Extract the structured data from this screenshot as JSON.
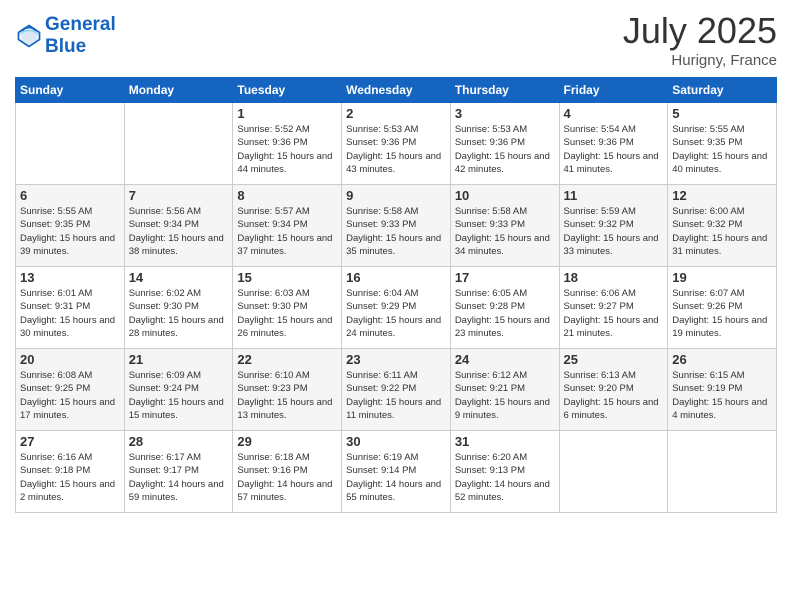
{
  "logo": {
    "line1": "General",
    "line2": "Blue"
  },
  "title": "July 2025",
  "location": "Hurigny, France",
  "weekdays": [
    "Sunday",
    "Monday",
    "Tuesday",
    "Wednesday",
    "Thursday",
    "Friday",
    "Saturday"
  ],
  "rows": [
    [
      {
        "day": "",
        "info": ""
      },
      {
        "day": "",
        "info": ""
      },
      {
        "day": "1",
        "info": "Sunrise: 5:52 AM\nSunset: 9:36 PM\nDaylight: 15 hours and 44 minutes."
      },
      {
        "day": "2",
        "info": "Sunrise: 5:53 AM\nSunset: 9:36 PM\nDaylight: 15 hours and 43 minutes."
      },
      {
        "day": "3",
        "info": "Sunrise: 5:53 AM\nSunset: 9:36 PM\nDaylight: 15 hours and 42 minutes."
      },
      {
        "day": "4",
        "info": "Sunrise: 5:54 AM\nSunset: 9:36 PM\nDaylight: 15 hours and 41 minutes."
      },
      {
        "day": "5",
        "info": "Sunrise: 5:55 AM\nSunset: 9:35 PM\nDaylight: 15 hours and 40 minutes."
      }
    ],
    [
      {
        "day": "6",
        "info": "Sunrise: 5:55 AM\nSunset: 9:35 PM\nDaylight: 15 hours and 39 minutes."
      },
      {
        "day": "7",
        "info": "Sunrise: 5:56 AM\nSunset: 9:34 PM\nDaylight: 15 hours and 38 minutes."
      },
      {
        "day": "8",
        "info": "Sunrise: 5:57 AM\nSunset: 9:34 PM\nDaylight: 15 hours and 37 minutes."
      },
      {
        "day": "9",
        "info": "Sunrise: 5:58 AM\nSunset: 9:33 PM\nDaylight: 15 hours and 35 minutes."
      },
      {
        "day": "10",
        "info": "Sunrise: 5:58 AM\nSunset: 9:33 PM\nDaylight: 15 hours and 34 minutes."
      },
      {
        "day": "11",
        "info": "Sunrise: 5:59 AM\nSunset: 9:32 PM\nDaylight: 15 hours and 33 minutes."
      },
      {
        "day": "12",
        "info": "Sunrise: 6:00 AM\nSunset: 9:32 PM\nDaylight: 15 hours and 31 minutes."
      }
    ],
    [
      {
        "day": "13",
        "info": "Sunrise: 6:01 AM\nSunset: 9:31 PM\nDaylight: 15 hours and 30 minutes."
      },
      {
        "day": "14",
        "info": "Sunrise: 6:02 AM\nSunset: 9:30 PM\nDaylight: 15 hours and 28 minutes."
      },
      {
        "day": "15",
        "info": "Sunrise: 6:03 AM\nSunset: 9:30 PM\nDaylight: 15 hours and 26 minutes."
      },
      {
        "day": "16",
        "info": "Sunrise: 6:04 AM\nSunset: 9:29 PM\nDaylight: 15 hours and 24 minutes."
      },
      {
        "day": "17",
        "info": "Sunrise: 6:05 AM\nSunset: 9:28 PM\nDaylight: 15 hours and 23 minutes."
      },
      {
        "day": "18",
        "info": "Sunrise: 6:06 AM\nSunset: 9:27 PM\nDaylight: 15 hours and 21 minutes."
      },
      {
        "day": "19",
        "info": "Sunrise: 6:07 AM\nSunset: 9:26 PM\nDaylight: 15 hours and 19 minutes."
      }
    ],
    [
      {
        "day": "20",
        "info": "Sunrise: 6:08 AM\nSunset: 9:25 PM\nDaylight: 15 hours and 17 minutes."
      },
      {
        "day": "21",
        "info": "Sunrise: 6:09 AM\nSunset: 9:24 PM\nDaylight: 15 hours and 15 minutes."
      },
      {
        "day": "22",
        "info": "Sunrise: 6:10 AM\nSunset: 9:23 PM\nDaylight: 15 hours and 13 minutes."
      },
      {
        "day": "23",
        "info": "Sunrise: 6:11 AM\nSunset: 9:22 PM\nDaylight: 15 hours and 11 minutes."
      },
      {
        "day": "24",
        "info": "Sunrise: 6:12 AM\nSunset: 9:21 PM\nDaylight: 15 hours and 9 minutes."
      },
      {
        "day": "25",
        "info": "Sunrise: 6:13 AM\nSunset: 9:20 PM\nDaylight: 15 hours and 6 minutes."
      },
      {
        "day": "26",
        "info": "Sunrise: 6:15 AM\nSunset: 9:19 PM\nDaylight: 15 hours and 4 minutes."
      }
    ],
    [
      {
        "day": "27",
        "info": "Sunrise: 6:16 AM\nSunset: 9:18 PM\nDaylight: 15 hours and 2 minutes."
      },
      {
        "day": "28",
        "info": "Sunrise: 6:17 AM\nSunset: 9:17 PM\nDaylight: 14 hours and 59 minutes."
      },
      {
        "day": "29",
        "info": "Sunrise: 6:18 AM\nSunset: 9:16 PM\nDaylight: 14 hours and 57 minutes."
      },
      {
        "day": "30",
        "info": "Sunrise: 6:19 AM\nSunset: 9:14 PM\nDaylight: 14 hours and 55 minutes."
      },
      {
        "day": "31",
        "info": "Sunrise: 6:20 AM\nSunset: 9:13 PM\nDaylight: 14 hours and 52 minutes."
      },
      {
        "day": "",
        "info": ""
      },
      {
        "day": "",
        "info": ""
      }
    ]
  ],
  "row_shades": [
    "white",
    "shade",
    "white",
    "shade",
    "white"
  ]
}
